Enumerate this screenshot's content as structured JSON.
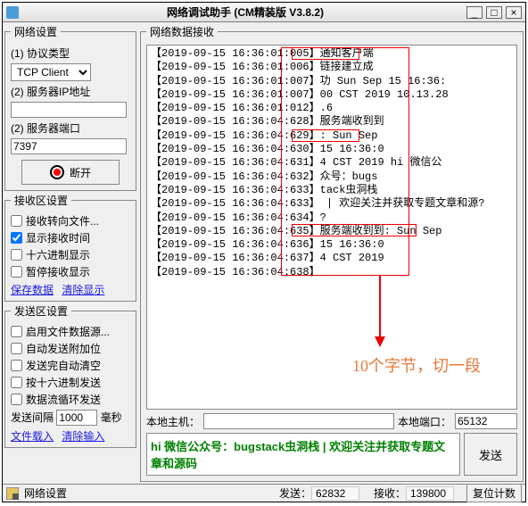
{
  "win": {
    "title": "网络调试助手 (CM精装版 V3.8.2)"
  },
  "net": {
    "group": "网络设置",
    "proto_label": "(1) 协议类型",
    "proto_value": "TCP Client",
    "ip_label": "(2) 服务器IP地址",
    "port_label": "(2) 服务器端口",
    "port_value": "7397",
    "disconnect": "断开"
  },
  "rx": {
    "group": "接收区设置",
    "cb1": "接收转向文件...",
    "cb2": "显示接收时间",
    "cb3": "十六进制显示",
    "cb4": "暂停接收显示",
    "link_save": "保存数据",
    "link_clear": "清除显示"
  },
  "tx": {
    "group": "发送区设置",
    "cb1": "启用文件数据源...",
    "cb2": "自动发送附加位",
    "cb3": "发送完自动清空",
    "cb4": "按十六进制发送",
    "cb5": "数据流循环发送",
    "interval_label": "发送间隔",
    "interval_value": "1000",
    "interval_unit": "毫秒",
    "link_load": "文件载入",
    "link_clear": "清除输入"
  },
  "recv": {
    "group": "网络数据接收",
    "lines": [
      "【2019-09-15 16:36:01:005】通知客户端",
      "【2019-09-15 16:36:01:006】链接建立成",
      "【2019-09-15 16:36:01:007】功 Sun Sep 15 16:36:",
      "【2019-09-15 16:36:01:007】00 CST 2019 10.13.28",
      "【2019-09-15 16:36:01:012】.6",
      "【2019-09-15 16:36:04:628】服务端收到到",
      "【2019-09-15 16:36:04:629】: Sun Sep",
      "【2019-09-15 16:36:04:630】15 16:36:0",
      "【2019-09-15 16:36:04:631】4 CST 2019 hi 微信公",
      "【2019-09-15 16:36:04:632】众号：bugs",
      "【2019-09-15 16:36:04:633】tack虫洞栈",
      "【2019-09-15 16:36:04:633】 | 欢迎关注并获取专题文章和源?",
      "【2019-09-15 16:36:04:634】?",
      "【2019-09-15 16:36:04:635】服务端收到到: Sun Sep",
      "【2019-09-15 16:36:04:636】15 16:36:0",
      "【2019-09-15 16:36:04:637】4 CST 2019",
      "【2019-09-15 16:36:04:638】"
    ],
    "annotation": "10个字节，切一段"
  },
  "host": {
    "local_lbl": "本地主机：",
    "remote_lbl": "本地端口：",
    "remote_val": "65132"
  },
  "send": {
    "text": "hi 微信公众号：bugstack虫洞栈 | 欢迎关注并获取专题文章和源码",
    "btn": "发送"
  },
  "status": {
    "label": "网络设置",
    "tx_lbl": "发送：",
    "tx_val": "62832",
    "rx_lbl": "接收：",
    "rx_val": "139800",
    "reset": "复位计数"
  }
}
